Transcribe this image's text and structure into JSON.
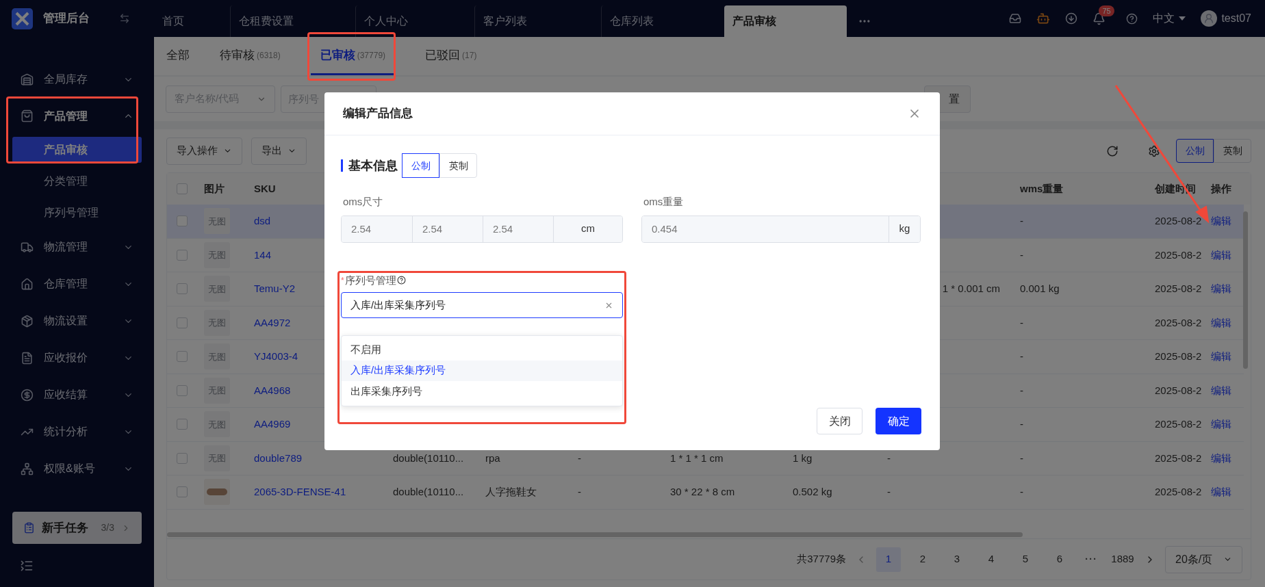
{
  "app": {
    "title": "管理后台"
  },
  "top_tabs": [
    {
      "label": "首页",
      "selected": false
    },
    {
      "label": "仓租费设置",
      "selected": false
    },
    {
      "label": "个人中心",
      "selected": false
    },
    {
      "label": "客户列表",
      "selected": false
    },
    {
      "label": "仓库列表",
      "selected": false
    },
    {
      "label": "产品审核",
      "selected": true
    }
  ],
  "header": {
    "notification_count": "75",
    "language": "中文",
    "user": "test07"
  },
  "sidebar": {
    "items": [
      {
        "label": "全局库存",
        "expanded": false
      },
      {
        "label": "产品管理",
        "expanded": true,
        "children": [
          {
            "label": "产品审核",
            "selected": true
          },
          {
            "label": "分类管理",
            "selected": false
          },
          {
            "label": "序列号管理",
            "selected": false
          }
        ]
      },
      {
        "label": "物流管理",
        "expanded": false
      },
      {
        "label": "仓库管理",
        "expanded": false
      },
      {
        "label": "物流设置",
        "expanded": false
      },
      {
        "label": "应收报价",
        "expanded": false
      },
      {
        "label": "应收结算",
        "expanded": false
      },
      {
        "label": "统计分析",
        "expanded": false
      },
      {
        "label": "权限&账号",
        "expanded": false
      }
    ],
    "task_card": {
      "label": "新手任务",
      "progress": "3/3",
      "completed": true
    }
  },
  "status_tabs": [
    {
      "label": "全部",
      "selected": false
    },
    {
      "label": "待审核",
      "count": "(6318)",
      "selected": false
    },
    {
      "label": "已审核",
      "count": "(37779)",
      "selected": true
    },
    {
      "label": "已驳回",
      "count": "(17)",
      "selected": false
    }
  ],
  "filters": {
    "customer": {
      "placeholder": "客户名称/代码"
    },
    "serial": {
      "placeholder": "序列号"
    },
    "reset_button": "置"
  },
  "toolbar": {
    "buttons": [
      "导入操作",
      "导出"
    ],
    "units": [
      {
        "label": "公制",
        "selected": true
      },
      {
        "label": "英制",
        "selected": false
      }
    ]
  },
  "table": {
    "columns": {
      "image": "图片",
      "sku": "SKU",
      "wms_weight": "wms重量",
      "created": "创建时间",
      "action": "操作"
    },
    "header_checked": false,
    "rows": [
      {
        "checked": false,
        "selected": true,
        "image": {
          "kind": "none",
          "text": "无图"
        },
        "sku": "dsd",
        "wms_weight": "-",
        "created": "2025-08-2",
        "action": "编辑"
      },
      {
        "checked": false,
        "selected": false,
        "image": {
          "kind": "none",
          "text": "无图"
        },
        "sku": "144",
        "wms_weight": "-",
        "created": "2025-08-2",
        "action": "编辑"
      },
      {
        "checked": false,
        "selected": false,
        "image": {
          "kind": "none",
          "text": "无图"
        },
        "sku": "Temu-Y2",
        "column_9": {
          "text": "1 * 0.001 cm",
          "cut": true
        },
        "wms_weight": "0.001 kg",
        "created": "2025-08-2",
        "action": "编辑"
      },
      {
        "checked": false,
        "selected": false,
        "image": {
          "kind": "none",
          "text": "无图"
        },
        "sku": "AA4972",
        "wms_weight": "-",
        "created": "2025-08-2",
        "action": "编辑"
      },
      {
        "checked": false,
        "selected": false,
        "image": {
          "kind": "none",
          "text": "无图"
        },
        "sku": "YJ4003-4",
        "wms_weight": "-",
        "created": "2025-08-2",
        "action": "编辑"
      },
      {
        "checked": false,
        "selected": false,
        "image": {
          "kind": "none",
          "text": "无图"
        },
        "sku": "AA4968",
        "wms_weight": "-",
        "created": "2025-08-2",
        "action": "编辑"
      },
      {
        "checked": false,
        "selected": false,
        "image": {
          "kind": "none",
          "text": "无图"
        },
        "sku": "AA4969",
        "wms_weight": "-",
        "created": "2025-08-2",
        "action": "编辑"
      },
      {
        "checked": false,
        "selected": false,
        "image": {
          "kind": "none",
          "text": "无图"
        },
        "sku": "double789",
        "column_4": "double(10110...",
        "column_5": "rpa",
        "column_6": "-",
        "column_7": "1 * 1 * 1 cm",
        "column_8": "1 kg",
        "column_9": "-",
        "wms_weight": "-",
        "created": "2025-08-2",
        "action": "编辑"
      },
      {
        "checked": false,
        "selected": false,
        "image": {
          "kind": "photo"
        },
        "sku": "2065-3D-FENSE-41",
        "column_4": "double(10110...",
        "column_5": "人字拖鞋女",
        "column_6": "-",
        "column_7": "30 * 22 * 8 cm",
        "column_8": "0.502 kg",
        "column_9": "-",
        "wms_weight": "-",
        "created": "2025-08-2",
        "action": "编辑"
      }
    ]
  },
  "pagination": {
    "total": "共37779条",
    "pages": [
      {
        "label": "1",
        "selected": true
      },
      {
        "label": "2",
        "selected": false
      },
      {
        "label": "3",
        "selected": false
      },
      {
        "label": "4",
        "selected": false
      },
      {
        "label": "5",
        "selected": false
      },
      {
        "label": "6",
        "selected": false
      },
      {
        "label": "···",
        "kind": "ellipsis",
        "selected": false
      },
      {
        "label": "1889",
        "selected": false
      }
    ],
    "page_size": "20条/页"
  },
  "dialog": {
    "title": "编辑产品信息",
    "section": "基本信息",
    "units": [
      {
        "label": "公制",
        "selected": true
      },
      {
        "label": "英制",
        "selected": false
      }
    ],
    "size": {
      "label": "oms尺寸",
      "values": [
        "2.54",
        "2.54",
        "2.54"
      ],
      "unit": "cm"
    },
    "weight": {
      "label": "oms重量",
      "value": "0.454",
      "unit": "kg"
    },
    "serial": {
      "required_mark": "*",
      "label": "序列号管理",
      "value": "入库/出库采集序列号",
      "options": [
        {
          "label": "不启用",
          "selected": false
        },
        {
          "label": "入库/出库采集序列号",
          "selected": true
        },
        {
          "label": "出库采集序列号",
          "selected": false
        }
      ]
    },
    "buttons": [
      {
        "label": "关闭",
        "kind": "default"
      },
      {
        "label": "确定",
        "kind": "primary"
      }
    ]
  }
}
